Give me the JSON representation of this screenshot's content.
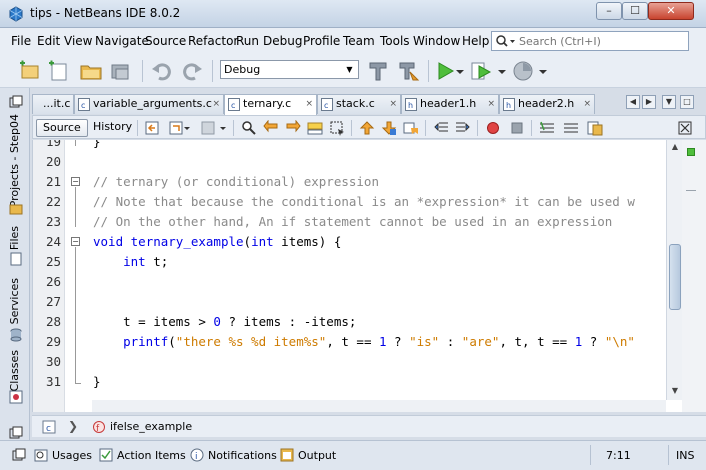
{
  "window": {
    "title": "tips - NetBeans IDE 8.0.2",
    "minimize_label": "–",
    "maximize_label": "☐",
    "close_label": "✕"
  },
  "menu": {
    "items": [
      "File",
      "Edit",
      "View",
      "Navigate",
      "Source",
      "Refactor",
      "Run",
      "Debug",
      "Profile",
      "Team",
      "Tools",
      "Window",
      "Help"
    ]
  },
  "search": {
    "placeholder": "Search (Ctrl+I)"
  },
  "toolbar": {
    "configuration": "Debug",
    "icons": [
      "new-project-icon",
      "new-file-icon",
      "open-project-icon",
      "close-project-icon",
      "undo-icon",
      "redo-icon",
      "build-icon",
      "clean-build-icon",
      "run-icon",
      "debug-icon",
      "profile-icon"
    ]
  },
  "left_panel": {
    "tabs": [
      "Projects - Step04",
      "Files",
      "Services",
      "Classes"
    ]
  },
  "editor_tabs": {
    "tabs": [
      {
        "label": "...it.c",
        "active": false
      },
      {
        "label": "variable_arguments.c",
        "active": false
      },
      {
        "label": "ternary.c",
        "active": true
      },
      {
        "label": "stack.c",
        "active": false
      },
      {
        "label": "header1.h",
        "active": false
      },
      {
        "label": "header2.h",
        "active": false
      }
    ],
    "close_glyph": "×"
  },
  "editor_toolbar": {
    "source_label": "Source",
    "history_label": "History"
  },
  "code": {
    "lines": [
      {
        "num": "19",
        "tokens": [
          {
            "t": "}",
            "c": "plain"
          }
        ]
      },
      {
        "num": "20",
        "tokens": []
      },
      {
        "num": "21",
        "tokens": [
          {
            "t": "// ternary (or conditional) expression",
            "c": "cmt"
          }
        ]
      },
      {
        "num": "22",
        "tokens": [
          {
            "t": "// Note that because the conditional is an *expression* it can be used w",
            "c": "cmt"
          }
        ]
      },
      {
        "num": "23",
        "tokens": [
          {
            "t": "// On the other hand, An if statement cannot be used in an expression",
            "c": "cmt"
          }
        ]
      },
      {
        "num": "24",
        "tokens": [
          {
            "t": "void ",
            "c": "kw"
          },
          {
            "t": "ternary_example",
            "c": "call"
          },
          {
            "t": "(",
            "c": "plain"
          },
          {
            "t": "int",
            "c": "kw"
          },
          {
            "t": " items) {",
            "c": "plain"
          }
        ]
      },
      {
        "num": "25",
        "tokens": [
          {
            "t": "    ",
            "c": "plain"
          },
          {
            "t": "int",
            "c": "kw"
          },
          {
            "t": " t;",
            "c": "plain"
          }
        ]
      },
      {
        "num": "26",
        "tokens": []
      },
      {
        "num": "27",
        "tokens": []
      },
      {
        "num": "28",
        "tokens": [
          {
            "t": "    t = items > ",
            "c": "plain"
          },
          {
            "t": "0",
            "c": "num"
          },
          {
            "t": " ? items : -items;",
            "c": "plain"
          }
        ]
      },
      {
        "num": "29",
        "tokens": [
          {
            "t": "    ",
            "c": "plain"
          },
          {
            "t": "printf",
            "c": "call"
          },
          {
            "t": "(",
            "c": "plain"
          },
          {
            "t": "\"there %s %d item%s\"",
            "c": "str"
          },
          {
            "t": ", t == ",
            "c": "plain"
          },
          {
            "t": "1",
            "c": "num"
          },
          {
            "t": " ? ",
            "c": "plain"
          },
          {
            "t": "\"is\"",
            "c": "str"
          },
          {
            "t": " : ",
            "c": "plain"
          },
          {
            "t": "\"are\"",
            "c": "str"
          },
          {
            "t": ", t, t == ",
            "c": "plain"
          },
          {
            "t": "1",
            "c": "num"
          },
          {
            "t": " ? ",
            "c": "plain"
          },
          {
            "t": "\"\\n\"",
            "c": "str"
          }
        ]
      },
      {
        "num": "30",
        "tokens": []
      },
      {
        "num": "31",
        "tokens": [
          {
            "t": "}",
            "c": "plain"
          }
        ]
      }
    ]
  },
  "breadcrumb": {
    "function": "ifelse_example"
  },
  "statusbar": {
    "usages": "Usages",
    "action_items": "Action Items",
    "notifications": "Notifications",
    "output": "Output",
    "position": "7:11",
    "mode": "INS"
  },
  "colors": {
    "keyword": "#0000e6",
    "comment": "#8a8a8a",
    "string": "#ce7b00"
  }
}
